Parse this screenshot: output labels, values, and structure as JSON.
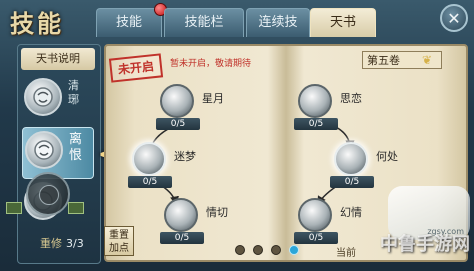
{
  "window": {
    "title": "技能"
  },
  "tabs": [
    {
      "label": "技能",
      "active": false,
      "has_badge": true
    },
    {
      "label": "技能栏",
      "active": false,
      "has_badge": false
    },
    {
      "label": "连续技",
      "active": false,
      "has_badge": false
    },
    {
      "label": "天书",
      "active": true,
      "has_badge": false
    }
  ],
  "close_button": {
    "icon": "close-icon",
    "label": "✕"
  },
  "left_panel": {
    "explain_button": "天书说明",
    "skills": [
      {
        "name": "清\n琊",
        "icon": "face-icon",
        "selected": false
      },
      {
        "name": "离\n恨",
        "icon": "face-icon",
        "selected": true
      },
      {
        "name": "",
        "icon": "face-icon",
        "selected": false
      }
    ],
    "repair_label": "重修",
    "repair_count": "3/3"
  },
  "book": {
    "stamp": "未开启",
    "notice": "暂未开启，敬请期待",
    "volume": "第五卷",
    "reset_button": "重置\n加点",
    "current_label": "当前",
    "page_dots": 4,
    "current_page_index": 3,
    "nodes_left": [
      {
        "name": "星月",
        "progress": "0/5",
        "highlight": false
      },
      {
        "name": "迷梦",
        "progress": "0/5",
        "highlight": true
      },
      {
        "name": "情切",
        "progress": "0/5",
        "highlight": false
      }
    ],
    "nodes_right": [
      {
        "name": "思恋",
        "progress": "0/5",
        "highlight": false
      },
      {
        "name": "何处",
        "progress": "0/5",
        "highlight": true
      },
      {
        "name": "幻情",
        "progress": "0/5",
        "highlight": false
      }
    ]
  },
  "watermark": {
    "text": "中鲁手游网",
    "sub": "zgsy.com"
  },
  "colors": {
    "accent": "#2ba6d8",
    "stamp": "#c0322a",
    "parchment": "#f0e8d2"
  }
}
